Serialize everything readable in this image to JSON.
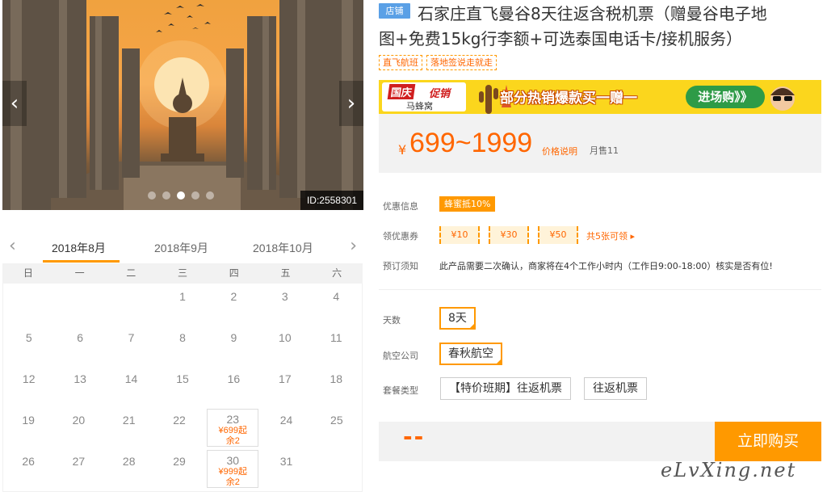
{
  "gallery": {
    "image_id": "ID:2558301",
    "prev_icon": "chevron-left-icon",
    "next_icon": "chevron-right-icon",
    "dot_count": 5,
    "active_dot": 3
  },
  "calendar": {
    "months": [
      "2018年8月",
      "2018年9月",
      "2018年10月"
    ],
    "active_month": "2018年8月",
    "weekdays": [
      "日",
      "一",
      "二",
      "三",
      "四",
      "五",
      "六"
    ],
    "weeks": [
      [
        {
          "d": ""
        },
        {
          "d": ""
        },
        {
          "d": ""
        },
        {
          "d": "1"
        },
        {
          "d": "2"
        },
        {
          "d": "3"
        },
        {
          "d": "4"
        }
      ],
      [
        {
          "d": "5"
        },
        {
          "d": "6"
        },
        {
          "d": "7"
        },
        {
          "d": "8"
        },
        {
          "d": "9"
        },
        {
          "d": "10"
        },
        {
          "d": "11"
        }
      ],
      [
        {
          "d": "12"
        },
        {
          "d": "13"
        },
        {
          "d": "14"
        },
        {
          "d": "15"
        },
        {
          "d": "16"
        },
        {
          "d": "17"
        },
        {
          "d": "18"
        }
      ],
      [
        {
          "d": "19"
        },
        {
          "d": "20"
        },
        {
          "d": "21"
        },
        {
          "d": "22"
        },
        {
          "d": "23",
          "price": "¥699起",
          "stock": "余2"
        },
        {
          "d": "24"
        },
        {
          "d": "25"
        }
      ],
      [
        {
          "d": "26"
        },
        {
          "d": "27"
        },
        {
          "d": "28"
        },
        {
          "d": "29"
        },
        {
          "d": "30",
          "price": "¥999起",
          "stock": "余2"
        },
        {
          "d": "31"
        },
        {
          "d": ""
        }
      ]
    ]
  },
  "product": {
    "shop_tag": "店铺",
    "title_line1": "石家庄直飞曼谷8天往返含税机票（赠曼谷电子地",
    "title_line2": "图+免费15kg行李额+可选泰国电话卡/接机服务）",
    "tags": [
      "直飞航班",
      "落地签说走就走"
    ],
    "banner": {
      "badge_a": "国庆",
      "badge_b": "促销",
      "brand": "马蜂窝",
      "headline": "部分热销爆款买一赠一",
      "cta": "进场购》》"
    },
    "currency": "¥",
    "price_range": "699~1999",
    "price_explain": "价格说明",
    "monthly_sales": "月售11",
    "promo_label": "优惠信息",
    "promo_tag": "蜂蜜抵10%",
    "coupon_label": "领优惠券",
    "coupons": [
      "¥10",
      "¥30",
      "¥50"
    ],
    "coupon_more": "共5张可领 ▸",
    "notice_label": "预订须知",
    "notice_text": "此产品需要二次确认，商家将在4个工作小时内（工作日9:00-18:00）核实是否有位!",
    "days_label": "天数",
    "days_value": "8天",
    "airline_label": "航空公司",
    "airline_value": "春秋航空",
    "package_label": "套餐类型",
    "packages": [
      "【特价班期】往返机票",
      "往返机票"
    ],
    "total_placeholder": "--",
    "buy_button": "立即购买",
    "watermark": "eLvXing.net"
  },
  "colors": {
    "accent": "#ff9900",
    "price": "#ff6600",
    "shop_tag": "#5aa0e6"
  }
}
